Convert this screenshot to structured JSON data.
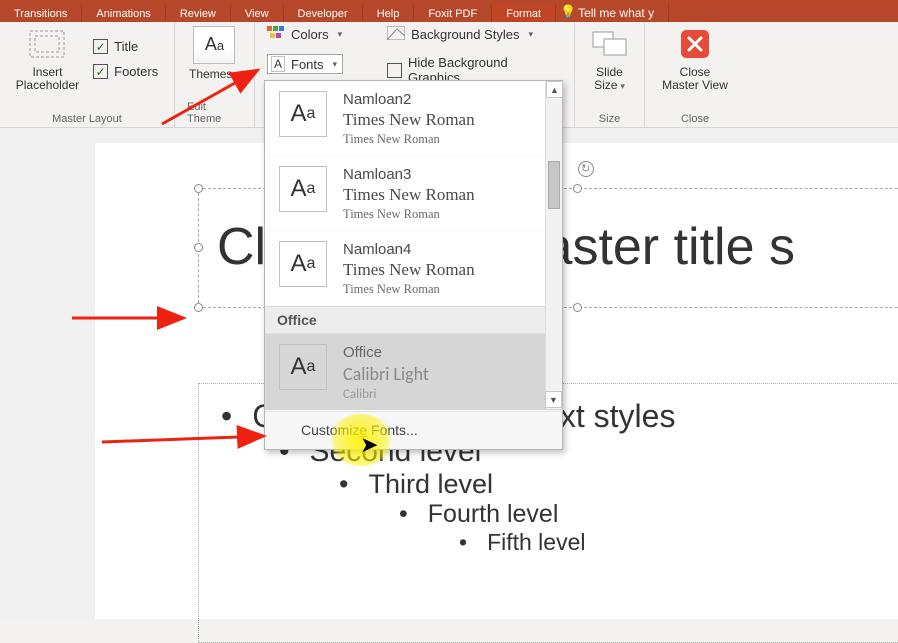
{
  "tabs": {
    "transitions": "Transitions",
    "animations": "Animations",
    "review": "Review",
    "view": "View",
    "developer": "Developer",
    "help": "Help",
    "foxit": "Foxit PDF",
    "format": "Format",
    "tellme": "Tell me what y"
  },
  "ribbon": {
    "master_layout": {
      "insert_ph": "Insert\nPlaceholder",
      "title": "Title",
      "footers": "Footers",
      "label": "Master Layout"
    },
    "edit_theme": {
      "themes": "Themes",
      "label": "Edit Theme"
    },
    "background": {
      "colors": "Colors",
      "fonts": "Fonts",
      "bgstyles": "Background Styles",
      "hidebg": "Hide Background Graphics"
    },
    "size": {
      "slide_size": "Slide\nSize",
      "label": "Size"
    },
    "close": {
      "close_master": "Close\nMaster View",
      "label": "Close"
    }
  },
  "fonts_dd": {
    "items": [
      {
        "name": "Namloan2",
        "heading": "Times New Roman",
        "body": "Times New Roman"
      },
      {
        "name": "Namloan3",
        "heading": "Times New Roman",
        "body": "Times New Roman"
      },
      {
        "name": "Namloan4",
        "heading": "Times New Roman",
        "body": "Times New Roman"
      }
    ],
    "office_header": "Office",
    "office": {
      "name": "Office",
      "heading": "Calibri Light",
      "body": "Calibri"
    },
    "customize_pre": "C",
    "customize_mid": "ustomiz",
    "customize_u": "e",
    "customize_post": " Fonts..."
  },
  "slide": {
    "title": "Click to edit Master title s",
    "l1": "Click to edit Master text styles",
    "l2": "Second level",
    "l3": "Third level",
    "l4": "Fourth level",
    "l5": "Fifth level"
  }
}
